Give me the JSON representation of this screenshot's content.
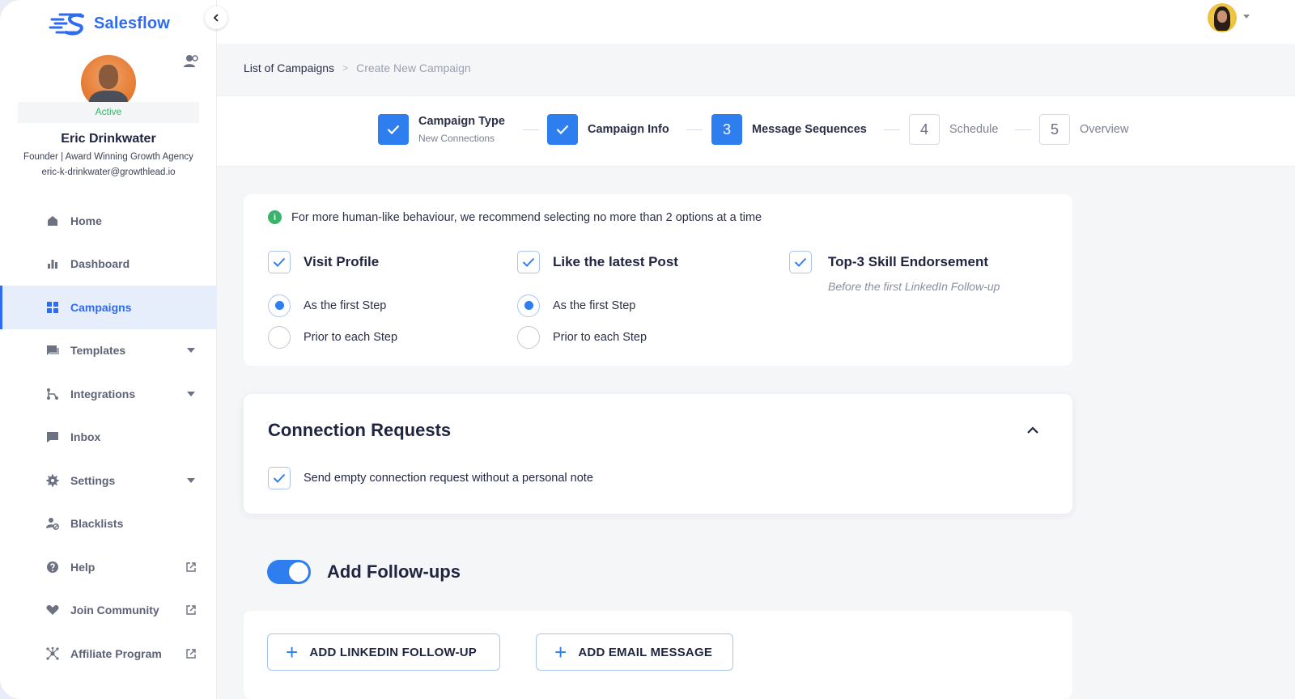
{
  "app": {
    "name": "Salesflow"
  },
  "user": {
    "status": "Active",
    "name": "Eric Drinkwater",
    "role": "Founder | Award Winning Growth Agency",
    "email": "eric-k-drinkwater@growthlead.io"
  },
  "nav": {
    "items": [
      {
        "label": "Home",
        "icon": "home-icon"
      },
      {
        "label": "Dashboard",
        "icon": "bar-chart-icon"
      },
      {
        "label": "Campaigns",
        "icon": "grid-icon",
        "active": true
      },
      {
        "label": "Templates",
        "icon": "chat-icon",
        "trail": "chevron-down-icon"
      },
      {
        "label": "Integrations",
        "icon": "flow-icon",
        "trail": "chevron-down-icon"
      },
      {
        "label": "Inbox",
        "icon": "message-icon"
      },
      {
        "label": "Settings",
        "icon": "gear-icon",
        "trail": "chevron-down-icon"
      },
      {
        "label": "Blacklists",
        "icon": "user-block-icon"
      },
      {
        "label": "Help",
        "icon": "help-icon",
        "trail": "external-link-icon"
      },
      {
        "label": "Join Community",
        "icon": "heart-hand-icon",
        "trail": "external-link-icon"
      },
      {
        "label": "Affiliate Program",
        "icon": "network-icon",
        "trail": "external-link-icon"
      }
    ]
  },
  "breadcrumb": {
    "parent": "List of Campaigns",
    "separator": ">",
    "current": "Create New Campaign"
  },
  "stepper": {
    "steps": [
      {
        "label": "Campaign Type",
        "sub": "New Connections",
        "state": "done"
      },
      {
        "label": "Campaign Info",
        "state": "done"
      },
      {
        "number": "3",
        "label": "Message Sequences",
        "state": "current"
      },
      {
        "number": "4",
        "label": "Schedule",
        "state": "todo"
      },
      {
        "number": "5",
        "label": "Overview",
        "state": "todo"
      }
    ]
  },
  "options": {
    "info": "For more human-like behaviour, we recommend selecting no more than 2 options at a time",
    "visit_profile": {
      "title": "Visit Profile",
      "checked": true,
      "radio_first": "As the first Step",
      "radio_each": "Prior to each Step",
      "selected": "first"
    },
    "like_post": {
      "title": "Like the latest Post",
      "checked": true,
      "radio_first": "As the first Step",
      "radio_each": "Prior to each Step",
      "selected": "first"
    },
    "endorsement": {
      "title": "Top-3 Skill Endorsement",
      "checked": true,
      "note": "Before the first LinkedIn Follow-up"
    }
  },
  "connection_requests": {
    "title": "Connection Requests",
    "empty_request_label": "Send empty connection request without a personal note",
    "empty_request_checked": true
  },
  "followups": {
    "label": "Add Follow-ups",
    "enabled": true,
    "add_linkedin": "ADD LINKEDIN FOLLOW-UP",
    "add_email": "ADD EMAIL MESSAGE"
  },
  "colors": {
    "accent": "#2f7ef0",
    "brand": "#2f6bf0",
    "active_status": "#3bb36b"
  }
}
